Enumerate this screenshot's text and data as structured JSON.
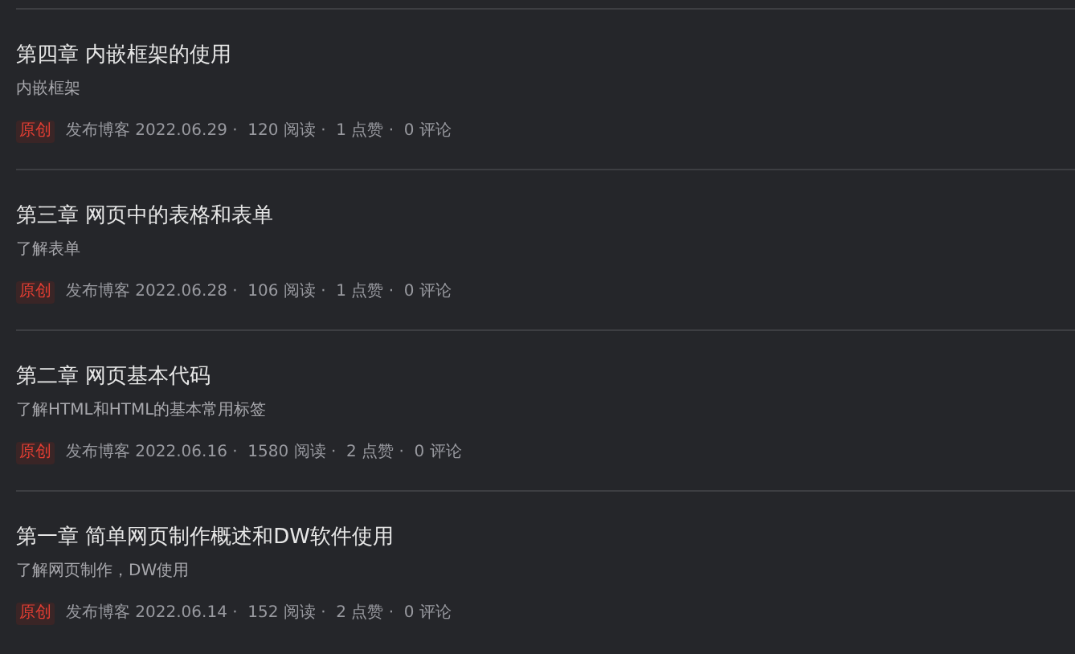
{
  "articles": [
    {
      "title": "第四章 内嵌框架的使用",
      "summary": "内嵌框架",
      "badge": "原创",
      "meta": "发布博客 2022.06.29 ·  120 阅读 ·  1 点赞 ·  0 评论"
    },
    {
      "title": "第三章 网页中的表格和表单",
      "summary": "了解表单",
      "badge": "原创",
      "meta": "发布博客 2022.06.28 ·  106 阅读 ·  1 点赞 ·  0 评论"
    },
    {
      "title": "第二章 网页基本代码",
      "summary": "了解HTML和HTML的基本常用标签",
      "badge": "原创",
      "meta": "发布博客 2022.06.16 ·  1580 阅读 ·  2 点赞 ·  0 评论"
    },
    {
      "title": "第一章 简单网页制作概述和DW软件使用",
      "summary": "了解网页制作，DW使用",
      "badge": "原创",
      "meta": "发布博客 2022.06.14 ·  152 阅读 ·  2 点赞 ·  0 评论"
    }
  ]
}
